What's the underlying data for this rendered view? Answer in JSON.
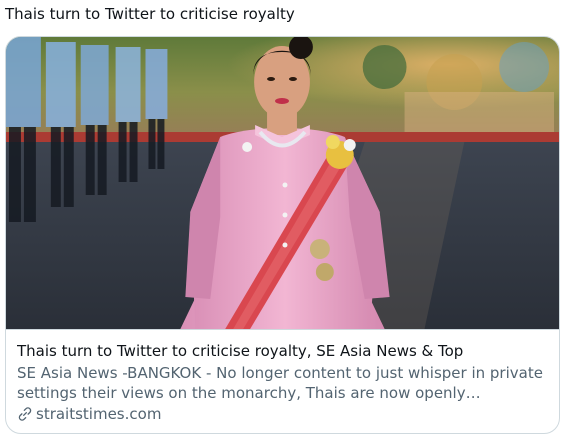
{
  "tweet": {
    "text": "Thais turn to Twitter to criticise royalty"
  },
  "card": {
    "image_icon": "photo-of-woman-in-pink-uniform-with-sash",
    "title": "Thais turn to Twitter to criticise royalty, SE Asia News & Top",
    "description": "SE Asia News -BANGKOK - No longer content to just whisper in private settings their views on the monarchy, Thais are now openly discussing…",
    "domain": "straitstimes.com",
    "domain_icon": "link-icon"
  },
  "colors": {
    "text_primary": "#0f1419",
    "text_secondary": "#536471",
    "border": "#cfd9de"
  }
}
